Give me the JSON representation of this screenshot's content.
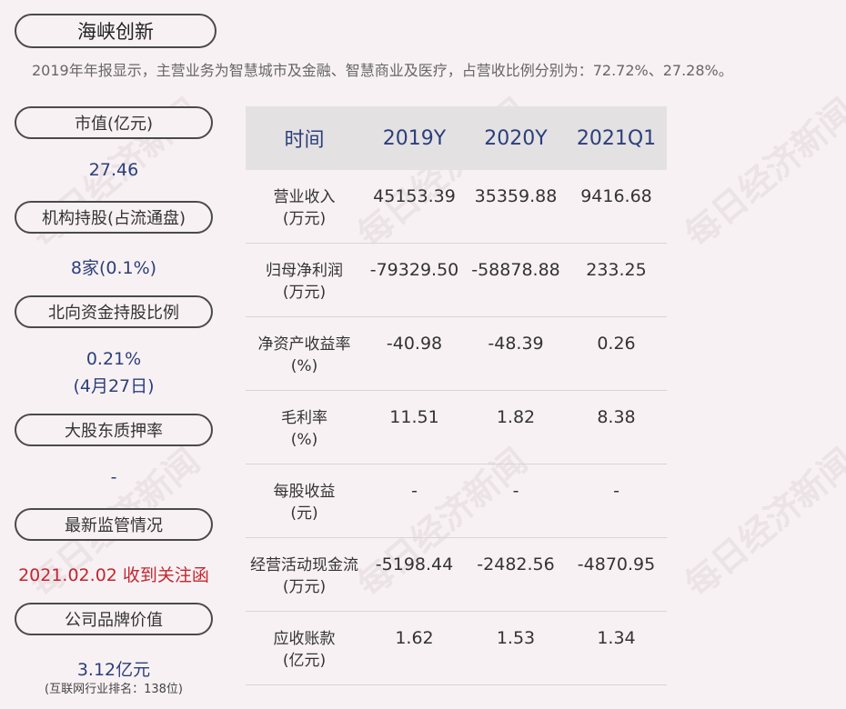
{
  "company": "海峡创新",
  "summary": "2019年年报显示，主营业务为智慧城市及金融、智慧商业及医疗，占营收比例分别为：72.72%、27.28%。",
  "left": {
    "market_cap_label": "市值(亿元)",
    "market_cap_value": "27.46",
    "institutions_label": "机构持股(占流通盘)",
    "institutions_value": "8家(0.1%)",
    "northbound_label": "北向资金持股比例",
    "northbound_value": "0.21%",
    "northbound_date": "(4月27日)",
    "pledge_label": "大股东质押率",
    "pledge_value": "-",
    "regulation_label": "最新监管情况",
    "regulation_value": "2021.02.02 收到关注函",
    "brand_label": "公司品牌价值",
    "brand_value": "3.12亿元",
    "brand_rank": "(互联网行业排名：138位)"
  },
  "table": {
    "headers": [
      "时间",
      "2019Y",
      "2020Y",
      "2021Q1"
    ],
    "rows": [
      {
        "label": "营业收入",
        "unit": "(万元)",
        "values": [
          "45153.39",
          "35359.88",
          "9416.68"
        ]
      },
      {
        "label": "归母净利润",
        "unit": "(万元)",
        "values": [
          "-79329.50",
          "-58878.88",
          "233.25"
        ]
      },
      {
        "label": "净资产收益率",
        "unit": "(%)",
        "values": [
          "-40.98",
          "-48.39",
          "0.26"
        ]
      },
      {
        "label": "毛利率",
        "unit": "(%)",
        "values": [
          "11.51",
          "1.82",
          "8.38"
        ]
      },
      {
        "label": "每股收益",
        "unit": "(元)",
        "values": [
          "-",
          "-",
          "-"
        ]
      },
      {
        "label": "经营活动现金流",
        "unit": "(万元)",
        "values": [
          "-5198.44",
          "-2482.56",
          "-4870.95"
        ]
      },
      {
        "label": "应收账款",
        "unit": "(亿元)",
        "values": [
          "1.62",
          "1.53",
          "1.34"
        ]
      }
    ]
  },
  "watermark": "每日经济新闻"
}
